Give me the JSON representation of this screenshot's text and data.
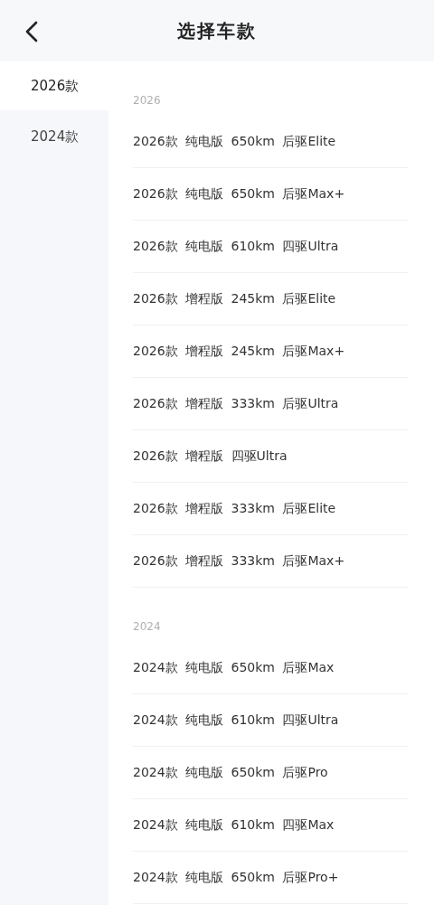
{
  "header": {
    "title": "选择车款"
  },
  "sidebar": {
    "items": [
      {
        "label": "2026款",
        "selected": true
      },
      {
        "label": "2024款",
        "selected": false
      }
    ]
  },
  "sections": [
    {
      "label": "2026",
      "rows": [
        "2026款 纯电版 650km 后驱Elite",
        "2026款 纯电版 650km 后驱Max+",
        "2026款 纯电版 610km 四驱Ultra",
        "2026款 增程版 245km 后驱Elite",
        "2026款 增程版 245km 后驱Max+",
        "2026款 增程版 333km 后驱Ultra",
        "2026款 增程版 四驱Ultra",
        "2026款 增程版 333km 后驱Elite",
        "2026款 增程版 333km 后驱Max+"
      ]
    },
    {
      "label": "2024",
      "rows": [
        "2024款 纯电版 650km 后驱Max",
        "2024款 纯电版 610km 四驱Ultra",
        "2024款 纯电版 650km 后驱Pro",
        "2024款 纯电版 610km 四驱Max",
        "2024款 纯电版 650km 后驱Pro+"
      ]
    }
  ]
}
